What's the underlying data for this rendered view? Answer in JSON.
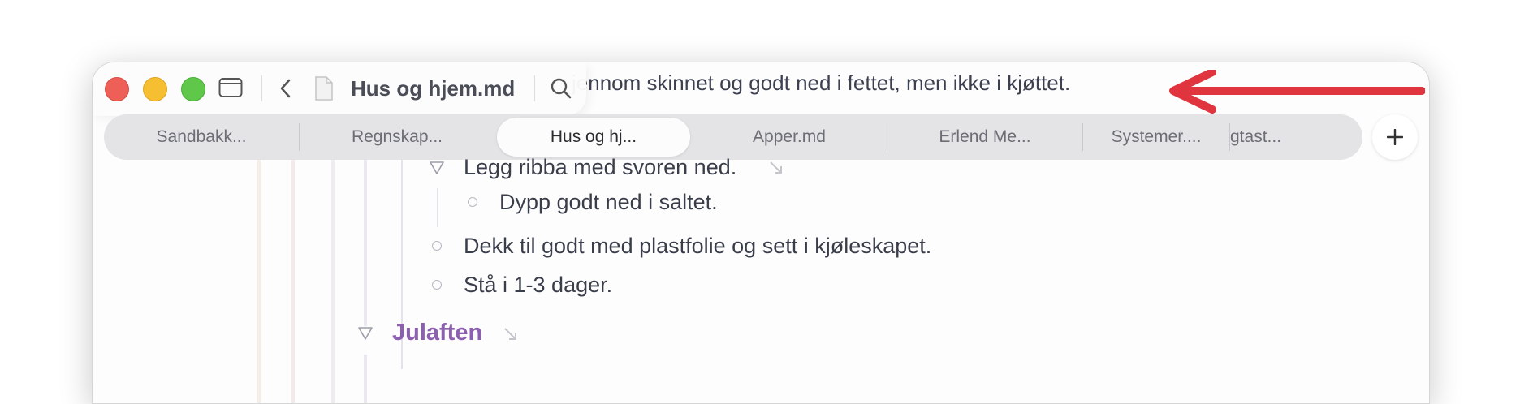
{
  "window": {
    "document_title": "Hus og hjem.md",
    "behind_text": "jennom skinnet og godt ned i fettet, men ikke i kjøttet."
  },
  "icons": {
    "sidebar_toggle": "sidebar-icon",
    "back": "chevron-left-icon",
    "document": "document-icon",
    "search": "search-icon",
    "add_tab": "plus-icon",
    "triangle": "disclosure-triangle-icon",
    "link": "link-arrow-icon"
  },
  "tabs": [
    {
      "label": "Sandbakk..."
    },
    {
      "label": "Regnskap..."
    },
    {
      "label": "Hus og hj..."
    },
    {
      "label": "Apper.md"
    },
    {
      "label": "Erlend Me..."
    },
    {
      "label": "Systemer...."
    },
    {
      "label": "gtast..."
    }
  ],
  "outline": {
    "item1": "Legg ribba med svoren ned.",
    "item1_child": "Dypp godt ned i saltet.",
    "item2": "Dekk til godt med plastfolie og sett i kjøleskapet.",
    "item3": "Stå i 1-3 dager.",
    "heading": "Julaften"
  },
  "colors": {
    "heading": "#8c5fb0",
    "annotation_arrow": "#e0343e",
    "traffic_red": "#ee5f58",
    "traffic_yellow": "#f6be31",
    "traffic_green": "#5fc84a"
  }
}
